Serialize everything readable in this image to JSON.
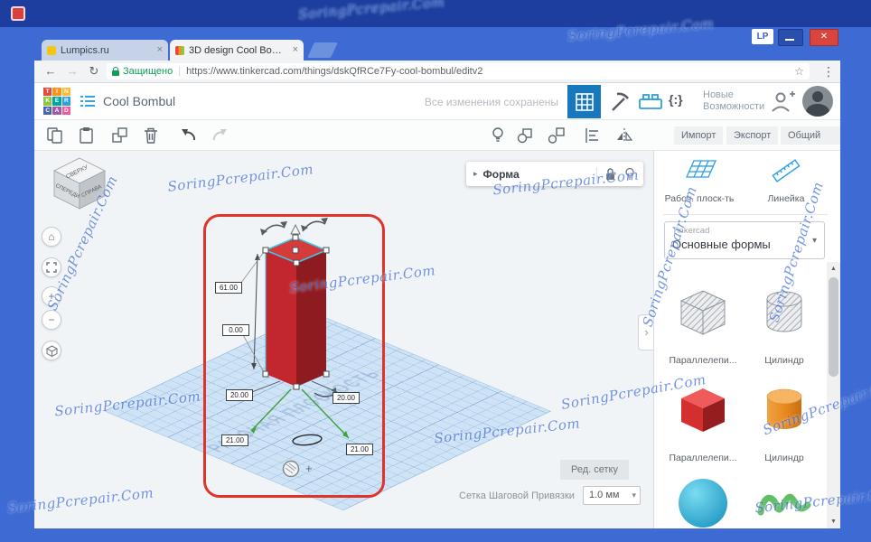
{
  "os": {
    "badge": "LP"
  },
  "browser": {
    "tab1": "Lumpics.ru",
    "tab2": "3D design Cool Bombul",
    "security": "Защищено",
    "url": "https://www.tinkercad.com/things/dskQfRCe7Fy-cool-bombul/editv2"
  },
  "header": {
    "logo": [
      "T",
      "I",
      "N",
      "K",
      "E",
      "R",
      "C",
      "A",
      "D"
    ],
    "title": "Cool Bombul",
    "saved": "Все изменения сохранены",
    "braces_icon": "{:}",
    "new_features_line1": "Новые",
    "new_features_line2": "Возможности"
  },
  "toolbar": {
    "import": "Импорт",
    "export": "Экспорт",
    "share": "Общий до..."
  },
  "viewcube": {
    "top": "СВЕРХУ",
    "front": "СПЕРЕДИ",
    "right": "СПРАВА"
  },
  "canvas": {
    "plane_label": "РАБОЧАЯ ПЛОСКОСТЬ",
    "shape_panel": "Форма",
    "dims": {
      "height": "61.00",
      "elev": "0.00",
      "w_left": "20.00",
      "w_right": "20.00",
      "d_left": "21.00",
      "d_right": "21.00"
    },
    "edit_grid": "Ред. сетку",
    "snap_label": "Сетка Шаговой Привязки",
    "snap_value": "1.0 мм"
  },
  "sidebar": {
    "workplane": "Рабоч. плоск-ть",
    "ruler": "Линейка",
    "brand": "Tinkercad",
    "category": "Основные формы",
    "shapes": [
      {
        "label": "Параллелепи..."
      },
      {
        "label": "Цилиндр"
      },
      {
        "label": "Параллелепи..."
      },
      {
        "label": "Цилиндр"
      },
      {
        "label": ""
      },
      {
        "label": ""
      }
    ]
  },
  "watermark": "SoringPcrepair.Com",
  "colors": {
    "desktop_blue": "#3d6bd3",
    "accent_blue": "#1878bd",
    "annotation_red": "#e0342b",
    "selection_cyan": "#3cc7ea"
  }
}
